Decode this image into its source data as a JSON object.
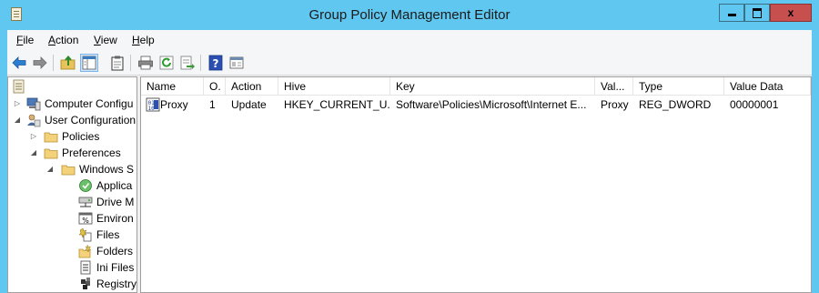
{
  "window": {
    "title": "Group Policy Management Editor",
    "minimize_glyph": "",
    "close_glyph": "x"
  },
  "menu": {
    "file": {
      "hot": "F",
      "rest": "ile"
    },
    "action": {
      "hot": "A",
      "rest": "ction"
    },
    "view": {
      "hot": "V",
      "rest": "iew"
    },
    "help": {
      "hot": "H",
      "rest": "elp"
    }
  },
  "toolbar": {
    "icons": [
      "back-arrow-icon",
      "forward-arrow-icon",
      "up-folder-icon",
      "show-hide-tree-icon",
      "clipboard-icon",
      "print-icon",
      "refresh-icon",
      "export-list-icon",
      "help-icon",
      "console-icon"
    ]
  },
  "tree": {
    "computer_config": "Computer Configu",
    "user_config": "User Configuration",
    "policies": "Policies",
    "preferences": "Preferences",
    "windows_settings": "Windows S",
    "applications": "Applica",
    "drive_maps": "Drive M",
    "environment": "Environ",
    "files": "Files",
    "folders": "Folders",
    "ini_files": "Ini Files",
    "registry": "Registry"
  },
  "list": {
    "columns": [
      "Name",
      "O.",
      "Action",
      "Hive",
      "Key",
      "Val...",
      "Type",
      "Value Data"
    ],
    "rows": [
      {
        "name": "Proxy",
        "order": "1",
        "action": "Update",
        "hive": "HKEY_CURRENT_U...",
        "key": "Software\\Policies\\Microsoft\\Internet E...",
        "value": "Proxy",
        "type": "REG_DWORD",
        "value_data": "00000001"
      }
    ]
  },
  "colors": {
    "titlebar": "#5fc7f0",
    "close_button": "#c7504f",
    "client_bg": "#f0f0f0"
  }
}
